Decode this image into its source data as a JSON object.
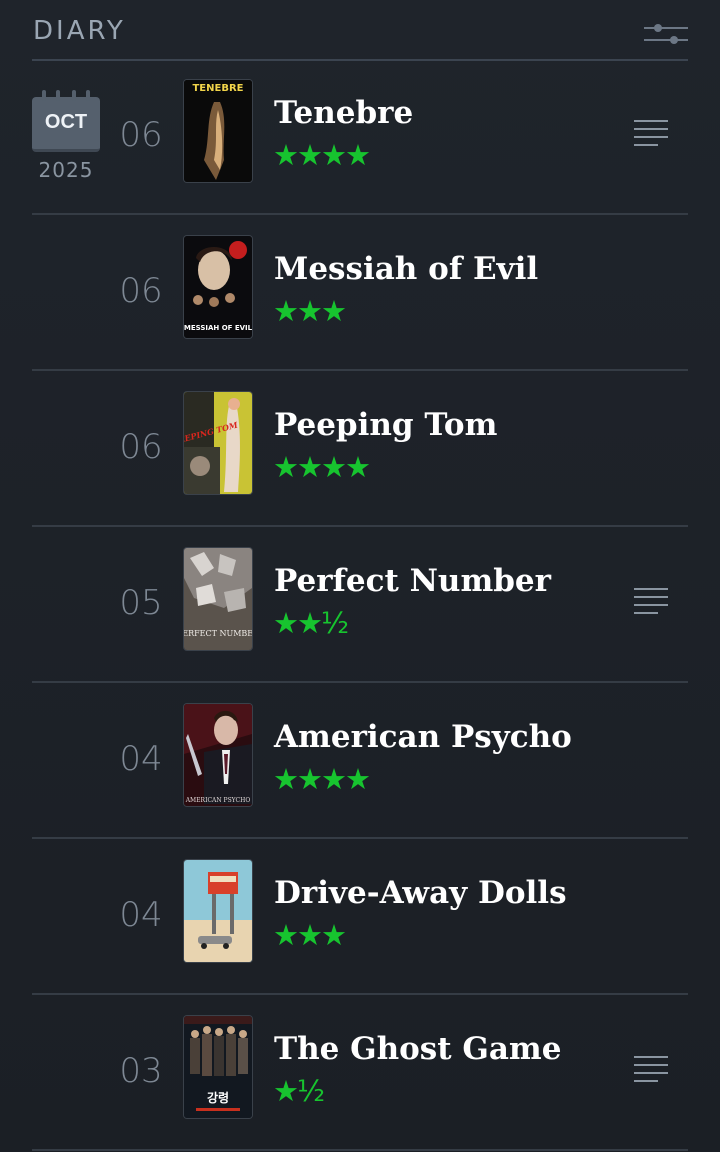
{
  "header": {
    "title": "DIARY"
  },
  "date": {
    "month": "OCT",
    "year": "2025"
  },
  "entries": [
    {
      "day": "06",
      "title": "Tenebre",
      "stars": "★★★★",
      "review": true,
      "poster_text": "TENEBRE"
    },
    {
      "day": "06",
      "title": "Messiah of Evil",
      "stars": "★★★",
      "review": false,
      "poster_text": "MESSIAH OF EVIL"
    },
    {
      "day": "06",
      "title": "Peeping Tom",
      "stars": "★★★★",
      "review": false,
      "poster_text": "PEEPING TOM"
    },
    {
      "day": "05",
      "title": "Perfect Number",
      "stars": "★★½",
      "review": true,
      "poster_text": "PERFECT NUMBER"
    },
    {
      "day": "04",
      "title": "American Psycho",
      "stars": "★★★★",
      "review": false,
      "poster_text": "AMERICAN PSYCHO"
    },
    {
      "day": "04",
      "title": "Drive-Away Dolls",
      "stars": "★★★",
      "review": false,
      "poster_text": ""
    },
    {
      "day": "03",
      "title": "The Ghost Game",
      "stars": "★½",
      "review": true,
      "poster_text": "강령"
    }
  ],
  "colors": {
    "star": "#17c42f",
    "accent": "#ffffff"
  },
  "icons": {
    "filter": "filter-sliders-icon",
    "review": "review-text-icon",
    "calendar": "calendar-icon"
  }
}
